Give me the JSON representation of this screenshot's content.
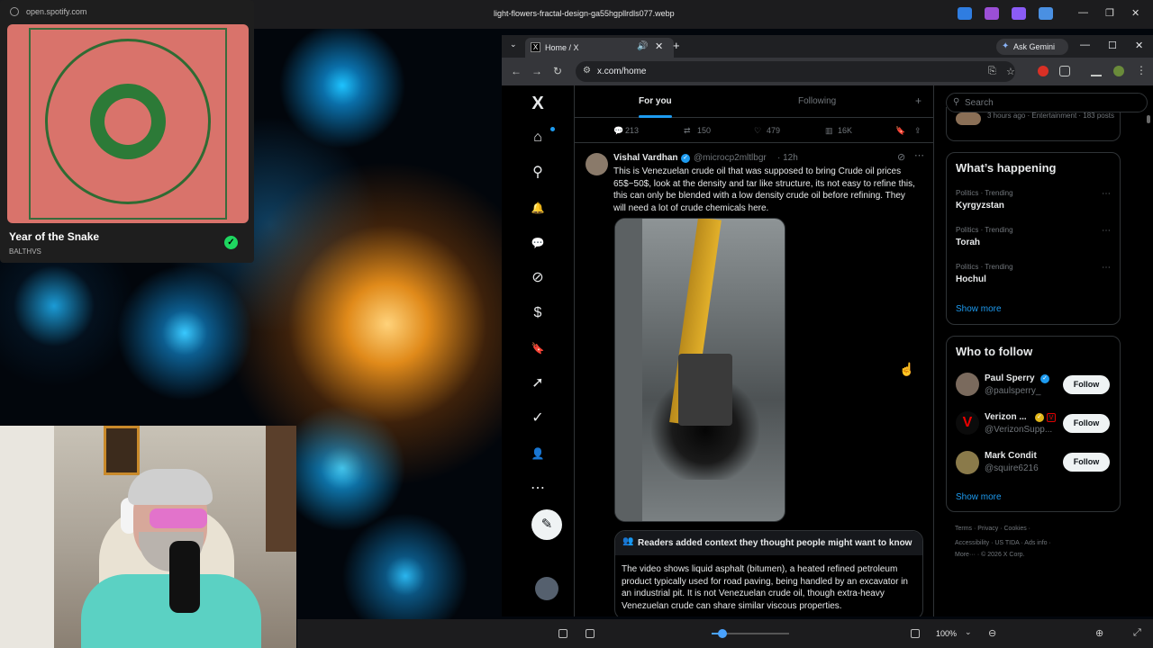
{
  "desktop": {
    "file_title": "light-flowers-fractal-design-ga55hgpllrdls077.webp"
  },
  "spotify": {
    "url": "open.spotify.com",
    "track_title": "Year of the Snake",
    "artist": "BALTHVS",
    "liked": "✓"
  },
  "browser": {
    "tab_title": "Home / X",
    "tab_favicon": "X",
    "tab_dropdown": "⌄",
    "tab_audio": "🔊",
    "tab_close": "✕",
    "new_tab": "+",
    "gemini_label": "Ask Gemini",
    "gemini_icon": "✦",
    "minimize": "—",
    "maximize": "☐",
    "close": "✕",
    "back": "←",
    "forward": "→",
    "reload": "↻",
    "site_info": "⚙",
    "url": "x.com/home",
    "install": "⎘",
    "bookmark": "☆",
    "menu": "⋮"
  },
  "x": {
    "logo": "X",
    "nav": {
      "home": "⌂",
      "explore": "⚲",
      "notifications": "🔔",
      "messages": "💬",
      "grok": "⊘",
      "premium": "$",
      "bookmarks": "🔖",
      "jobs": "➚",
      "verified_orgs": "✓",
      "profile": "👤",
      "more": "⋯"
    },
    "post_button": "✎",
    "tabs": {
      "for_you": "For you",
      "following": "Following",
      "add": "+"
    },
    "prev_actions": {
      "replies": "213",
      "reposts": "150",
      "likes": "479",
      "views": "16K",
      "reply_icon": "💬",
      "repost_icon": "⇄",
      "like_icon": "♡",
      "views_icon": "▥",
      "bookmark_icon": "🔖",
      "share_icon": "⇪"
    },
    "post": {
      "name": "Vishal Vardhan",
      "verified": "✓",
      "handle": "@microcp2mltlbgr",
      "time": "· 12h",
      "grok_icon": "⊘",
      "more_icon": "⋯",
      "text": "This is Venezuelan crude oil that was supposed to bring Crude oil prices 65$~50$, look at the density and tar like structure, its not easy to refine this, this can only be blended with a low density crude oil before refining. They will need a lot of crude chemicals here."
    },
    "community_note": {
      "icon": "👥",
      "title": "Readers added context they thought people might want to know",
      "body": "The video shows liquid asphalt (bitumen), a heated refined petroleum product typically used for road paving, being handled by an excavator in an industrial pit. It is not Venezuelan crude oil, though extra-heavy Venezuelan crude can share similar viscous properties."
    },
    "sidebar": {
      "search_icon": "⚲",
      "search_placeholder": "Search",
      "top_card_meta": "3 hours ago · Entertainment · 183 posts",
      "whats_happening_title": "What’s happening",
      "trends": [
        {
          "category": "Politics · Trending",
          "name": "Kyrgyzstan"
        },
        {
          "category": "Politics · Trending",
          "name": "Torah"
        },
        {
          "category": "Politics · Trending",
          "name": "Hochul"
        }
      ],
      "trend_more": "⋯",
      "show_more": "Show more",
      "who_to_follow_title": "Who to follow",
      "follow_suggestions": [
        {
          "name": "Paul Sperry",
          "handle": "@paulsperry_",
          "button": "Follow",
          "badge": "✓",
          "badge_color": "#1d9bf0",
          "avatar_color": "#7a6a5d"
        },
        {
          "name": "Verizon ...",
          "handle": "@VerizonSupp...",
          "button": "Follow",
          "badge": "✓",
          "badge_color": "#e2b719",
          "avatar_color": "#0b0b0b"
        },
        {
          "name": "Mark Condit",
          "handle": "@squire6216",
          "button": "Follow",
          "badge": "",
          "badge_color": "",
          "avatar_color": "#8a7a4a"
        }
      ],
      "show_more_follow": "Show more",
      "footer": {
        "line1": "Terms  ·  Privacy  ·  Cookies  ·",
        "line2": "Accessibility  ·  US TIDA  ·  Ads info  ·",
        "line3": "More···  ·  © 2026 X Corp."
      }
    }
  },
  "viewer": {
    "zoom": "100%",
    "zoom_dropdown": "⌄",
    "zoom_out": "⊖",
    "zoom_in": "⊕",
    "fullscreen": "⤢",
    "zoom_level": 0.14
  },
  "colors": {
    "accent": "#1d9bf0",
    "spotify_green": "#1ed760"
  }
}
